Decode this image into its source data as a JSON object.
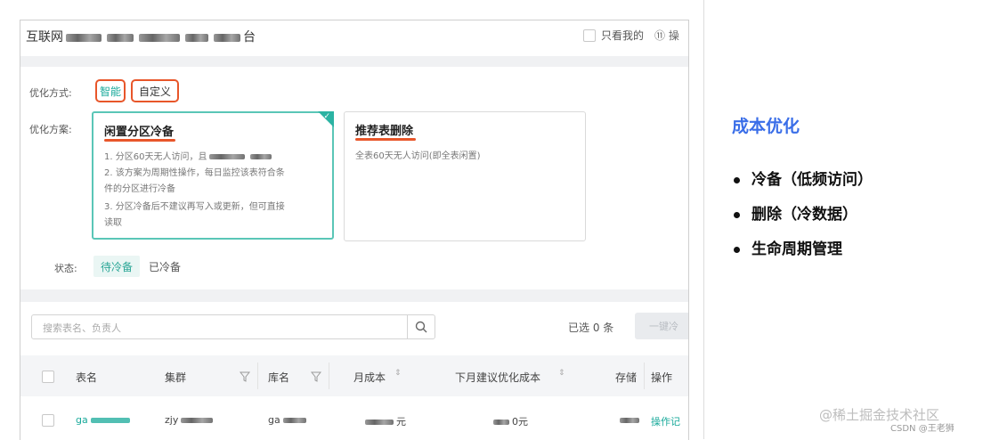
{
  "header": {
    "title_prefix": "互联网",
    "title_suffix": "台",
    "only_mine_label": "只看我的",
    "op_label": "⑪ 操"
  },
  "filters": {
    "method_label": "优化方式:",
    "method_smart": "智能",
    "method_custom": "自定义",
    "plan_label": "优化方案:",
    "status_label": "状态:",
    "status_pending": "待冷备",
    "status_done": "已冷备"
  },
  "plans": [
    {
      "title": "闲置分区冷备",
      "lines": [
        "1. 分区60天无人访问，且",
        "2. 该方案为周期性操作，每日监控该表符合条",
        "件的分区进行冷备",
        "3. 分区冷备后不建议再写入或更新，但可直接",
        "读取"
      ]
    },
    {
      "title": "推荐表删除",
      "lines": [
        "全表60天无人访问(即全表闲置)"
      ]
    }
  ],
  "search": {
    "placeholder": "搜索表名、负责人",
    "selected_count": "已选 0 条",
    "batch_button": "一键冷"
  },
  "table": {
    "columns": [
      "表名",
      "集群",
      "库名",
      "月成本",
      "下月建议优化成本",
      "存储",
      "操作"
    ],
    "row": {
      "name": "ga",
      "cluster": "zjy",
      "db": "ga",
      "cost": "元",
      "next_cost": "0元",
      "action": "操作记"
    }
  },
  "side": {
    "title": "成本优化",
    "bullets": [
      "冷备（低频访问）",
      "删除（冷数据）",
      "生命周期管理"
    ],
    "watermark": "@稀土掘金技术社区",
    "csdn": "CSDN @王老狮"
  },
  "colors": {
    "accent_teal": "#18a99a",
    "highlight_red": "#e8562a",
    "title_blue": "#3a6ee8"
  }
}
